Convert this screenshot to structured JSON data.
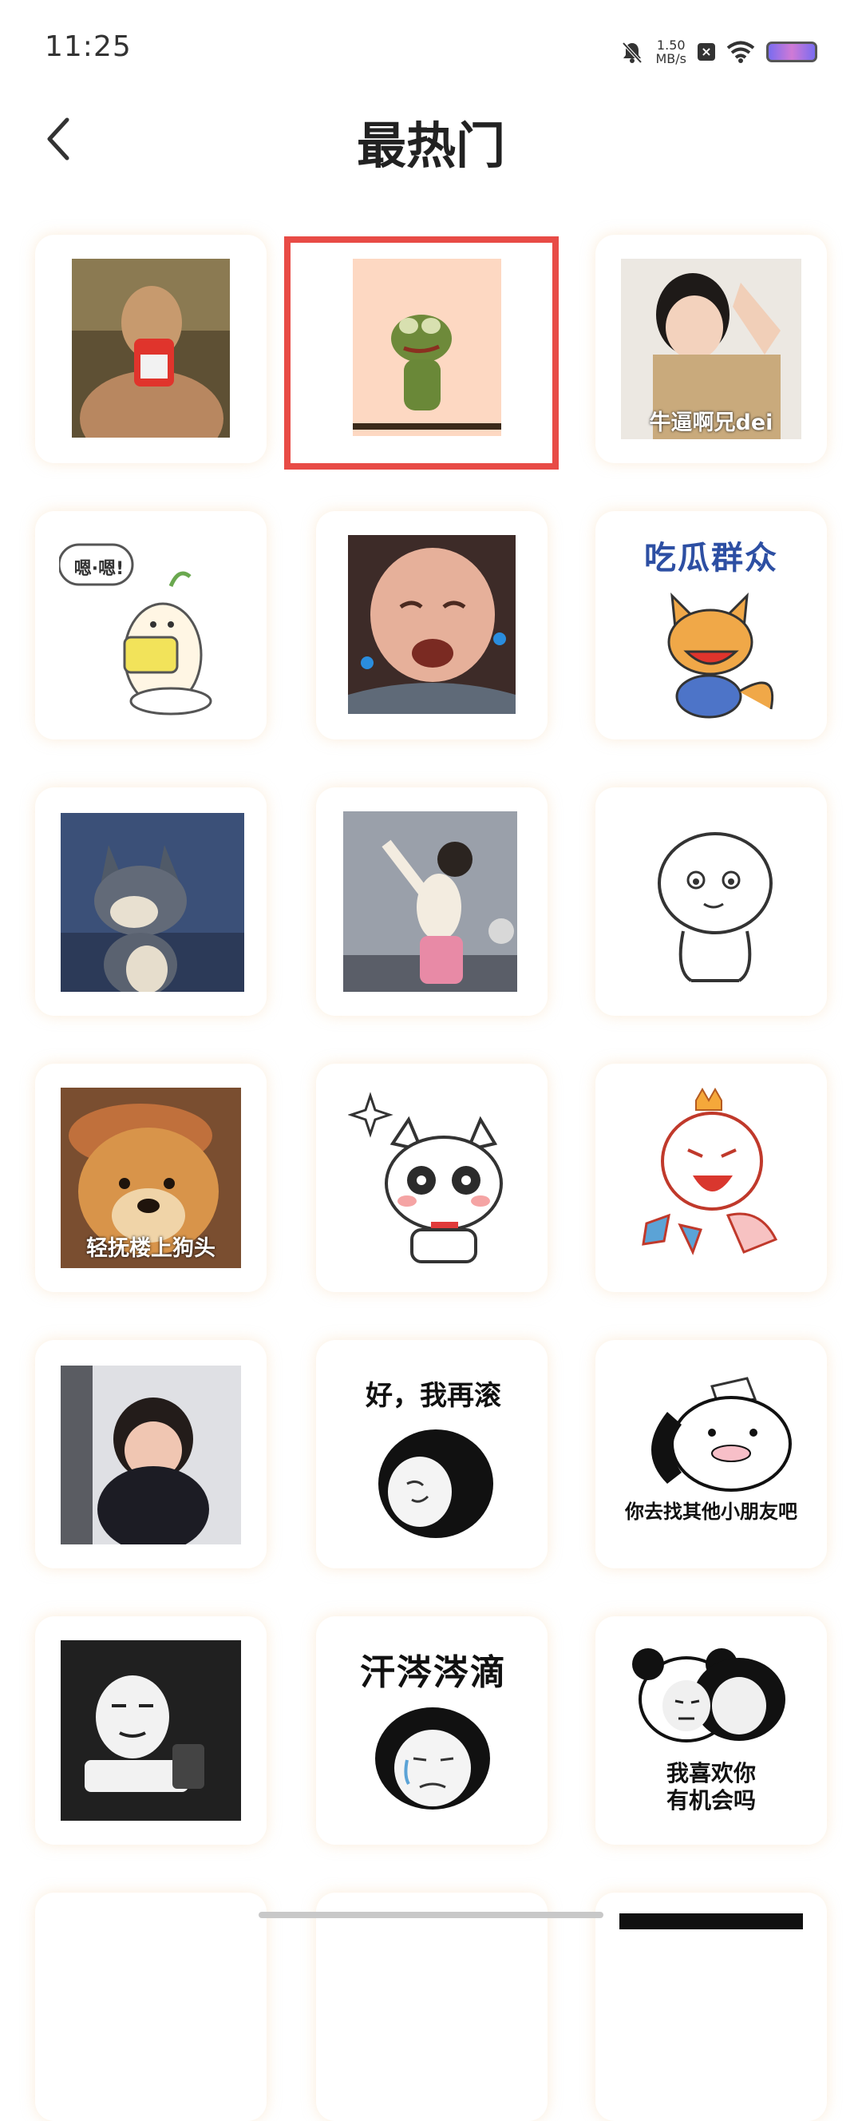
{
  "status_bar": {
    "time": "11:25",
    "net_speed_value": "1.50",
    "net_speed_unit": "MB/s",
    "icons": [
      "mute-icon",
      "close-app-icon",
      "wifi-icon",
      "battery-icon"
    ]
  },
  "header": {
    "back_icon": "chevron-left-icon",
    "title": "最热门"
  },
  "stickers": {
    "r2c3_caption": "牛逼啊兄dei",
    "r3c1_speech": "嗯·嗯!",
    "r3c3_caption": "吃瓜群众",
    "r5c1_caption": "轻抚楼上狗头",
    "r6c2_caption": "好，我再滚",
    "r6c3_caption": "你去找其他小朋友吧",
    "r7c2_caption": "汗涔涔滴",
    "r7c3_caption_line1": "我喜欢你",
    "r7c3_caption_line2": "有机会吗"
  },
  "colors": {
    "selection_border": "#e84b46",
    "card_glow": "#f0c896",
    "title_text": "#222222"
  }
}
